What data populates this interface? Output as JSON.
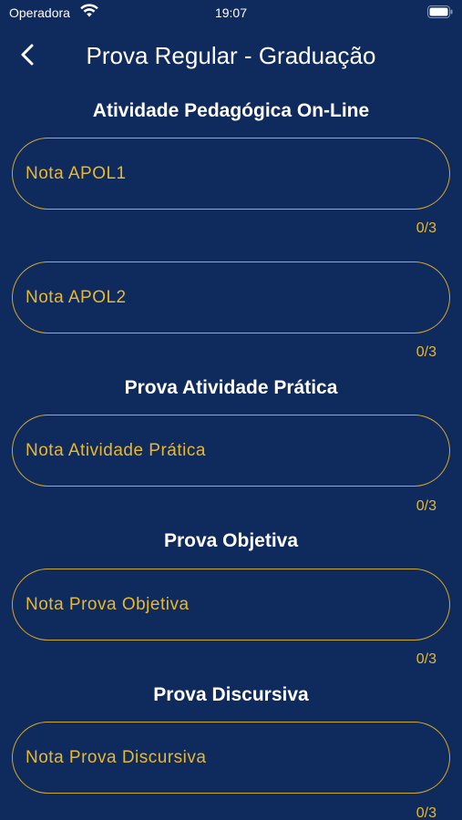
{
  "status_bar": {
    "carrier": "Operadora",
    "time": "19:07"
  },
  "header": {
    "title": "Prova Regular - Graduação"
  },
  "sections": [
    {
      "title": "Atividade Pedagógica On-Line",
      "fields": [
        {
          "placeholder": "Nota APOL1",
          "value": "",
          "counter": "0/3"
        },
        {
          "placeholder": "Nota APOL2",
          "value": "",
          "counter": "0/3"
        }
      ]
    },
    {
      "title": "Prova Atividade Prática",
      "fields": [
        {
          "placeholder": "Nota Atividade Prática",
          "value": "",
          "counter": "0/3"
        }
      ]
    },
    {
      "title": "Prova Objetiva",
      "fields": [
        {
          "placeholder": "Nota Prova Objetiva",
          "value": "",
          "counter": "0/3"
        }
      ]
    },
    {
      "title": "Prova Discursiva",
      "fields": [
        {
          "placeholder": "Nota Prova Discursiva",
          "value": "",
          "counter": "0/3"
        }
      ]
    }
  ],
  "colors": {
    "background": "#0f2a5c",
    "accent": "#e8b830",
    "border": "#d4a82a",
    "text": "#ffffff"
  },
  "icons": {
    "back": "chevron-left-icon",
    "wifi": "wifi-icon",
    "battery": "battery-icon"
  }
}
